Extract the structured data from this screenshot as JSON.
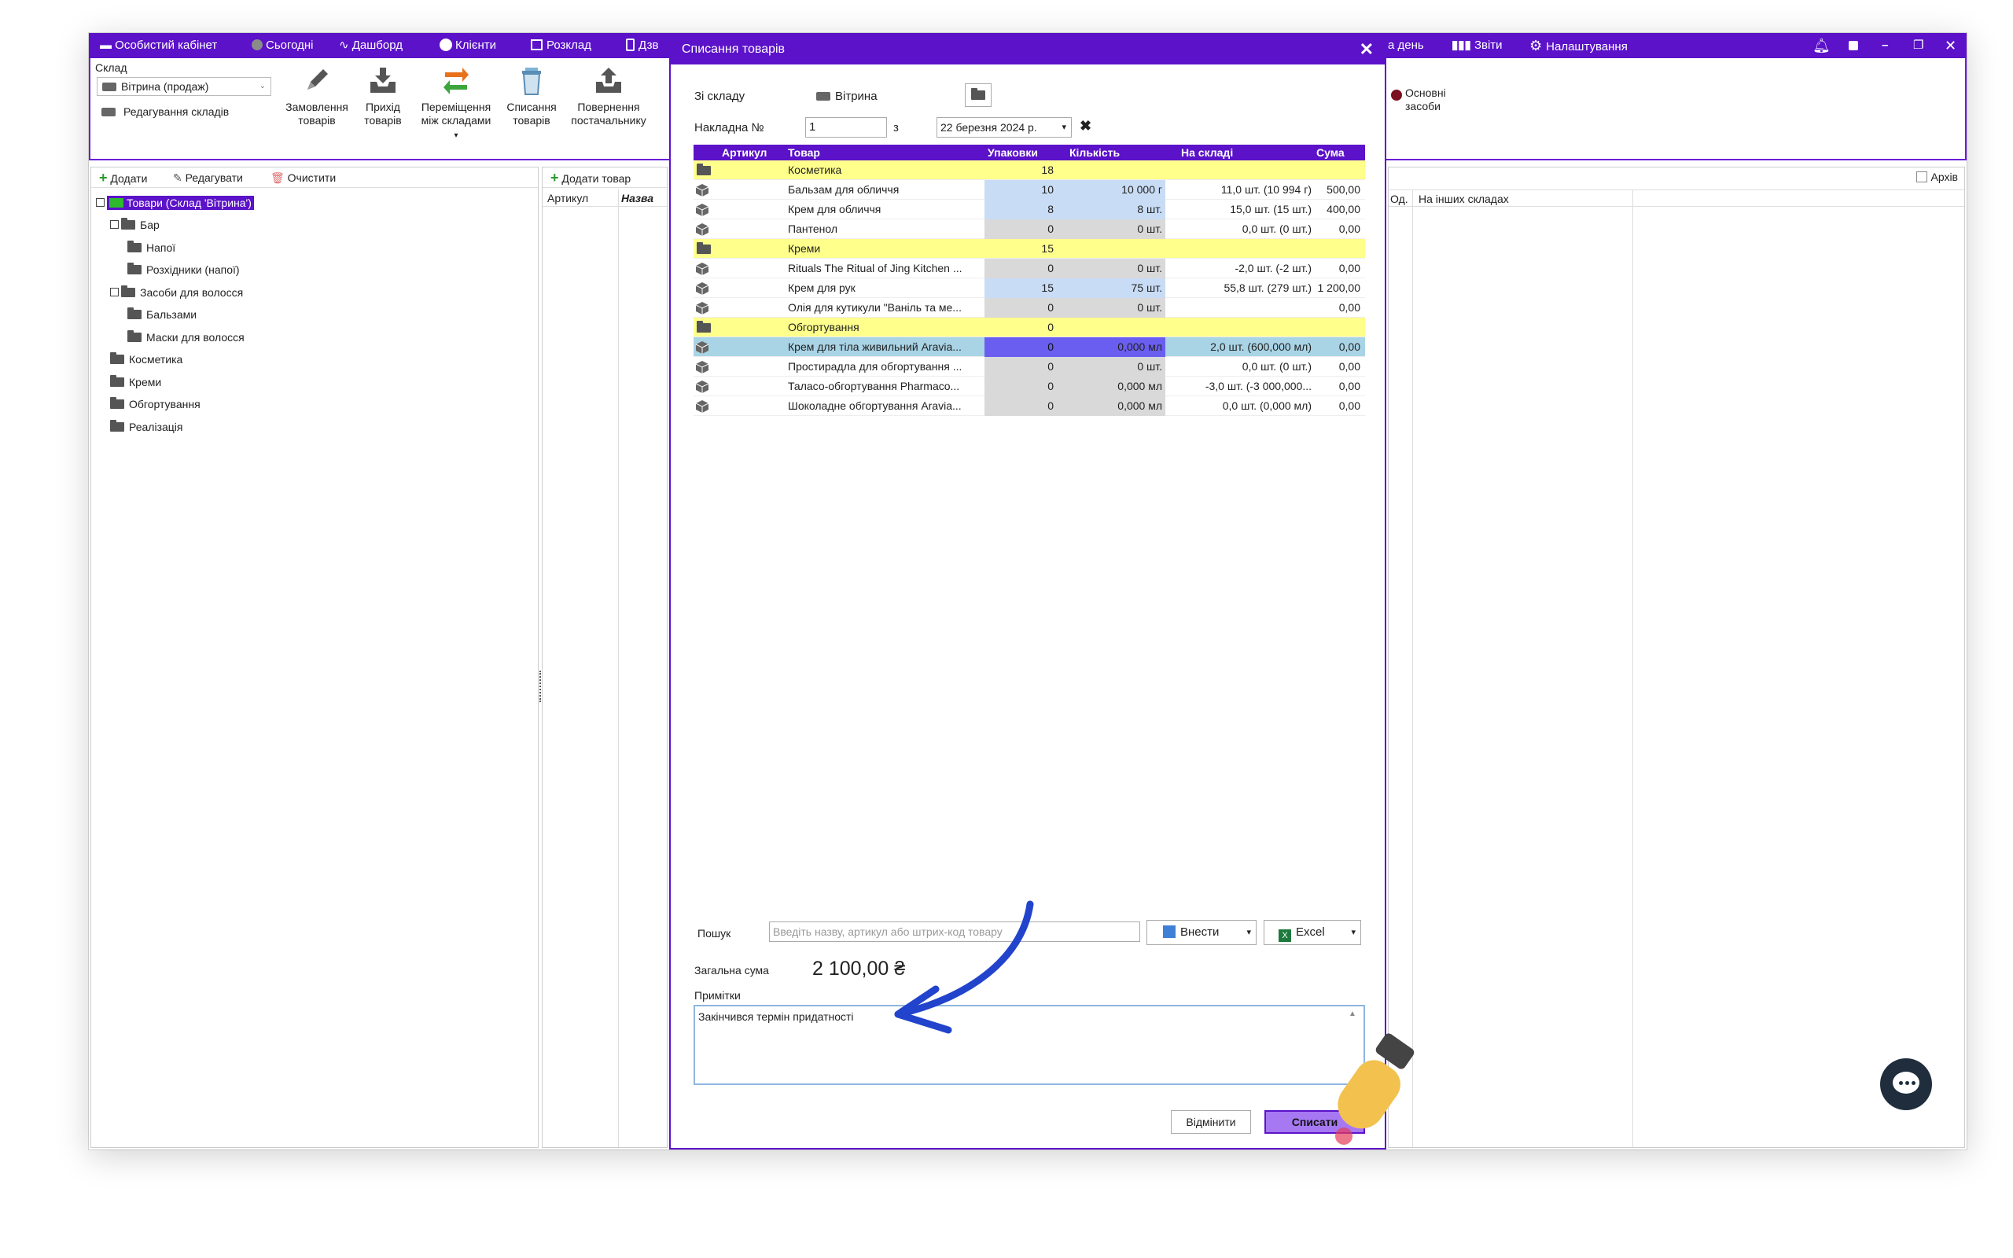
{
  "topbar": {
    "items": [
      {
        "icon": "briefcase-icon",
        "label": "Особистий кабінет"
      },
      {
        "icon": "circle-icon",
        "label": "Сьогодні"
      },
      {
        "icon": "pulse-icon",
        "label": "Дашборд"
      },
      {
        "icon": "user-icon",
        "label": "Клієнти"
      },
      {
        "icon": "calendar-icon",
        "label": "Розклад"
      },
      {
        "icon": "phone-icon",
        "label": "Дзв"
      }
    ],
    "right_items": [
      {
        "icon": "",
        "label": "а день"
      },
      {
        "icon": "bar-chart-icon",
        "label": "Звіти"
      },
      {
        "icon": "gear-icon",
        "label": "Налаштування"
      }
    ]
  },
  "ribbon": {
    "warehouse_label": "Склад",
    "warehouse_value": "Вітрина (продаж)",
    "edit_warehouses": "Редагування складів",
    "buttons": [
      {
        "icon": "pencil-icon",
        "label1": "Замовлення",
        "label2": "товарів"
      },
      {
        "icon": "inbox-in-icon",
        "label1": "Прихід",
        "label2": "товарів"
      },
      {
        "icon": "swap-arrows-icon",
        "label1": "Переміщення",
        "label2": "між складами"
      },
      {
        "icon": "trash-icon",
        "label1": "Списання",
        "label2": "товарів"
      },
      {
        "icon": "inbox-out-icon",
        "label1": "Повернення",
        "label2": "постачальнику"
      }
    ],
    "assets_label1": "Основні",
    "assets_label2": "засоби"
  },
  "left_toolbar": {
    "add": "Додати",
    "edit": "Редагувати",
    "clear": "Очистити"
  },
  "tree": {
    "root": "Товари (Склад 'Вітрина')",
    "nodes": [
      {
        "label": "Бар",
        "level": 1,
        "expand": true
      },
      {
        "label": "Напої",
        "level": 2
      },
      {
        "label": "Розхідники (напої)",
        "level": 2
      },
      {
        "label": "Засоби для волосся",
        "level": 1,
        "expand": true
      },
      {
        "label": "Бальзами",
        "level": 2
      },
      {
        "label": "Маски для волосся",
        "level": 2
      },
      {
        "label": "Косметика",
        "level": 1
      },
      {
        "label": "Креми",
        "level": 1
      },
      {
        "label": "Обгортування",
        "level": 1
      },
      {
        "label": "Реалізація",
        "level": 1
      }
    ]
  },
  "middle": {
    "add_product": "Додати товар",
    "col_article": "Артикул",
    "col_name": "Назва"
  },
  "right_pane": {
    "archive": "Архів",
    "col_unit": "Од.",
    "col_other": "На інших складах"
  },
  "modal": {
    "title": "Списання товарів",
    "from_label": "Зі складу",
    "from_value": "Вітрина",
    "invoice_label": "Накладна  №",
    "invoice_no": "1",
    "from_word": "з",
    "date": "22  березня  2024 р.",
    "columns": [
      "Артикул",
      "Товар",
      "Упаковки",
      "Кількість",
      "На складі",
      "Сума"
    ],
    "rows": [
      {
        "type": "group",
        "name": "Косметика",
        "packs": "18"
      },
      {
        "type": "item",
        "name": "Бальзам для обличчя",
        "packs": "10",
        "qty": "10 000 г",
        "stock": "11,0 шт. (10 994 г)",
        "sum": "500,00",
        "packs_bg": "#c9dcf5",
        "qty_bg": "#c9dcf5"
      },
      {
        "type": "item",
        "name": "Крем для обличчя",
        "packs": "8",
        "qty": "8 шт.",
        "stock": "15,0 шт. (15 шт.)",
        "sum": "400,00",
        "packs_bg": "#c9dcf5",
        "qty_bg": "#c9dcf5"
      },
      {
        "type": "item",
        "name": "Пантенол",
        "packs": "0",
        "qty": "0 шт.",
        "stock": "0,0 шт. (0 шт.)",
        "sum": "0,00",
        "packs_bg": "#d9d9d9",
        "qty_bg": "#d9d9d9"
      },
      {
        "type": "group",
        "name": "Креми",
        "packs": "15"
      },
      {
        "type": "item",
        "name": "Rituals The Ritual of Jing Kitchen ...",
        "packs": "0",
        "qty": "0 шт.",
        "stock": "-2,0 шт. (-2 шт.)",
        "sum": "0,00",
        "packs_bg": "#d9d9d9",
        "qty_bg": "#d9d9d9"
      },
      {
        "type": "item",
        "name": "Крем для рук",
        "packs": "15",
        "qty": "75 шт.",
        "stock": "55,8 шт. (279 шт.)",
        "sum": "1 200,00",
        "packs_bg": "#c9dcf5",
        "qty_bg": "#c9dcf5"
      },
      {
        "type": "item",
        "name": "Олія для кутикули \"Ваніль та ме...",
        "packs": "0",
        "qty": "0 шт.",
        "stock": "",
        "sum": "0,00",
        "packs_bg": "#d9d9d9",
        "qty_bg": "#d9d9d9"
      },
      {
        "type": "group",
        "name": "Обгортування",
        "packs": "0"
      },
      {
        "type": "selected",
        "name": "Крем для тіла живильний Aravia...",
        "packs": "0",
        "qty": "0,000 мл",
        "stock": "2,0 шт. (600,000 мл)",
        "sum": "0,00",
        "packs_bg": "#6a5ef0",
        "qty_bg": "#6a5ef0"
      },
      {
        "type": "item",
        "name": "Простирадла для обгортування ...",
        "packs": "0",
        "qty": "0 шт.",
        "stock": "0,0 шт. (0 шт.)",
        "sum": "0,00",
        "packs_bg": "#d9d9d9",
        "qty_bg": "#d9d9d9"
      },
      {
        "type": "item",
        "name": "Таласо-обгортування Pharmaco...",
        "packs": "0",
        "qty": "0,000 мл",
        "stock": "-3,0 шт. (-3 000,000...",
        "sum": "0,00",
        "packs_bg": "#d9d9d9",
        "qty_bg": "#d9d9d9"
      },
      {
        "type": "item",
        "name": "Шоколадне обгортування Aravia...",
        "packs": "0",
        "qty": "0,000 мл",
        "stock": "0,0 шт. (0,000 мл)",
        "sum": "0,00",
        "packs_bg": "#d9d9d9",
        "qty_bg": "#d9d9d9"
      }
    ],
    "search_label": "Пошук",
    "search_placeholder": "Введіть назву, артикул або штрих-код товару",
    "enter_btn": "Внести",
    "excel_btn": "Excel",
    "total_label": "Загальна сума",
    "total_value": "2 100,00 ₴",
    "notes_label": "Примітки",
    "notes_value": "Закінчився термін придатності",
    "cancel_btn": "Відмінити",
    "submit_btn": "Списати"
  },
  "colors": {
    "accent": "#5b12c9",
    "group_row": "#ffff8c",
    "selected_row": "#a9d4e6"
  }
}
